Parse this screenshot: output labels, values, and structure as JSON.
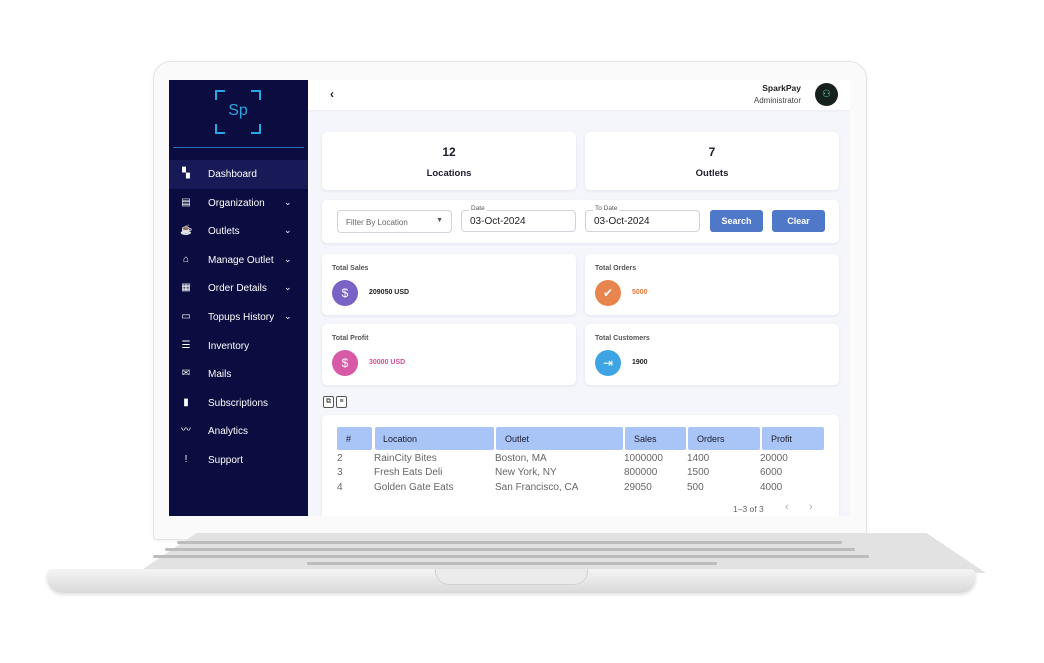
{
  "brand": {
    "logo_text": "Sp"
  },
  "sidebar": {
    "items": [
      {
        "label": "Dashboard",
        "icon": "dashboard-icon",
        "glyph": "▚",
        "chevron": false,
        "active": true
      },
      {
        "label": "Organization",
        "icon": "organization-icon",
        "glyph": "▤",
        "chevron": true,
        "active": false
      },
      {
        "label": "Outlets",
        "icon": "cup-icon",
        "glyph": "☕",
        "chevron": true,
        "active": false
      },
      {
        "label": "Manage Outlet",
        "icon": "store-icon",
        "glyph": "⌂",
        "chevron": true,
        "active": false
      },
      {
        "label": "Order Details",
        "icon": "receipt-icon",
        "glyph": "▦",
        "chevron": true,
        "active": false
      },
      {
        "label": "Topups History",
        "icon": "wallet-icon",
        "glyph": "▭",
        "chevron": true,
        "active": false
      },
      {
        "label": "Inventory",
        "icon": "inventory-icon",
        "glyph": "☰",
        "chevron": false,
        "active": false
      },
      {
        "label": "Mails",
        "icon": "mail-icon",
        "glyph": "✉",
        "chevron": false,
        "active": false
      },
      {
        "label": "Subscriptions",
        "icon": "subscription-icon",
        "glyph": "▮",
        "chevron": false,
        "active": false
      },
      {
        "label": "Analytics",
        "icon": "analytics-icon",
        "glyph": "〰",
        "chevron": false,
        "active": false
      },
      {
        "label": "Support",
        "icon": "support-icon",
        "glyph": "!",
        "chevron": false,
        "active": false
      }
    ]
  },
  "header": {
    "back_glyph": "‹",
    "user_name": "SparkPay",
    "user_role": "Administrator"
  },
  "summary": {
    "locations": {
      "value": "12",
      "label": "Locations"
    },
    "outlets": {
      "value": "7",
      "label": "Outlets"
    }
  },
  "filters": {
    "location_placeholder": "Filter By Location",
    "date_label": "Date",
    "date_value": "03-Oct-2024",
    "to_date_label": "To Date",
    "to_date_value": "03-Oct-2024",
    "search_label": "Search",
    "clear_label": "Clear"
  },
  "metrics": {
    "total_sales": {
      "title": "Total Sales",
      "value": "209050 USD",
      "color": "#7b63c6",
      "value_color": "#222222"
    },
    "total_orders": {
      "title": "Total Orders",
      "value": "5000",
      "color": "#e8854f",
      "value_color": "#e07a3f"
    },
    "total_profit": {
      "title": "Total Profit",
      "value": "30000 USD",
      "color": "#d65aa6",
      "value_color": "#cf4d9c"
    },
    "total_customers": {
      "title": "Total Customers",
      "value": "1900",
      "color": "#3ea4e3",
      "value_color": "#222222"
    }
  },
  "table": {
    "headers": [
      "#",
      "Location",
      "Outlet",
      "Sales",
      "Orders",
      "Profit"
    ],
    "rows": [
      [
        "2",
        "RainCity Bites",
        "Boston, MA",
        "1000000",
        "1400",
        "20000"
      ],
      [
        "3",
        "Fresh Eats Deli",
        "New York, NY",
        "800000",
        "1500",
        "6000"
      ],
      [
        "4",
        "Golden Gate Eats",
        "San Francisco, CA",
        "29050",
        "500",
        "4000"
      ]
    ],
    "pagination": "1–3 of 3"
  },
  "colors": {
    "sidebar_bg": "#0b0c3f",
    "accent": "#4f78c9",
    "table_header": "#a9c4f7",
    "logo": "#2aa7e1"
  }
}
